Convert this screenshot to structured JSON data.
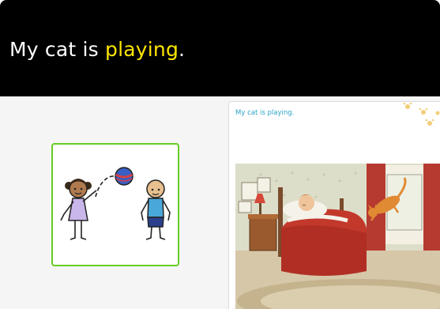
{
  "header": {
    "sentence_before": "My cat is ",
    "highlight_word": "playing",
    "sentence_after": ".",
    "colors": {
      "background": "#000000",
      "text": "#ffffff",
      "highlight": "#ffe600"
    }
  },
  "symbol_card": {
    "icon": "children-playing-ball-symbol",
    "border_color": "#66cc22"
  },
  "story_page": {
    "caption": "My cat is playing.",
    "caption_color": "#2aa3c8",
    "illustration": "cat-jumping-in-bedroom-illustration",
    "decoration": "paw-prints-icon"
  }
}
